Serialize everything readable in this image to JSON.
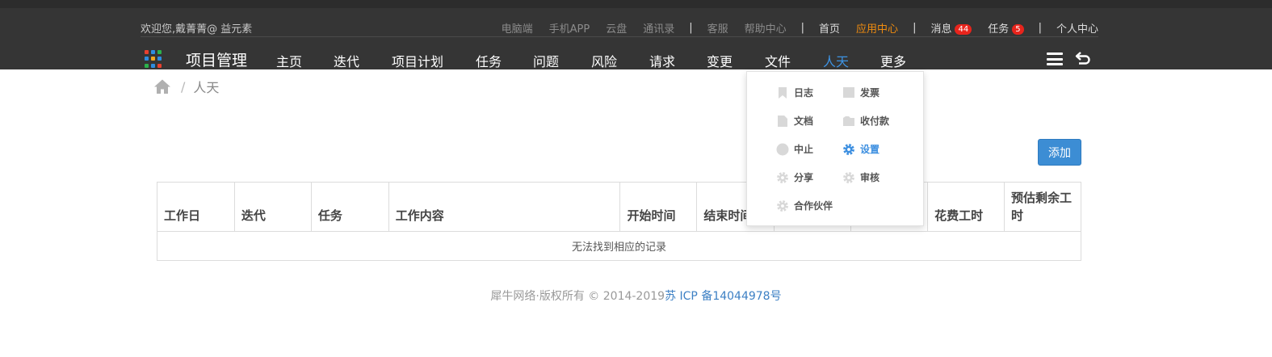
{
  "header": {
    "welcome": "欢迎您,戴菁菁@ 益元素",
    "utility_links": [
      {
        "label": "电脑端",
        "style": "dim"
      },
      {
        "label": "手机APP",
        "style": "dim"
      },
      {
        "label": "云盘",
        "style": "dim"
      },
      {
        "label": "通讯录",
        "style": "dim"
      },
      {
        "label": "客服",
        "style": "dim"
      },
      {
        "label": "帮助中心",
        "style": "dim"
      },
      {
        "label": "首页",
        "style": "light"
      },
      {
        "label": "应用中心",
        "style": "accent"
      },
      {
        "label": "消息",
        "badge": "44"
      },
      {
        "label": "任务",
        "badge": "5"
      },
      {
        "label": "个人中心",
        "style": "light"
      }
    ],
    "separator": "|",
    "brand": "项目管理",
    "nav": [
      "主页",
      "迭代",
      "项目计划",
      "任务",
      "问题",
      "风险",
      "请求",
      "变更",
      "文件",
      "人天",
      "更多"
    ],
    "active_nav": "人天",
    "icons": {
      "apps": "apps-grid-icon",
      "menu": "hamburger-menu-icon",
      "back": "back-arrow-icon"
    }
  },
  "breadcrumb": {
    "separator": "/",
    "current": "人天"
  },
  "toolbar": {
    "add_label": "添加"
  },
  "table": {
    "columns": [
      "工作日",
      "迭代",
      "任务",
      "工作内容",
      "开始时间",
      "结束时间",
      "",
      "",
      "花费工时",
      "预估剩余工时"
    ],
    "empty_text": "无法找到相应的记录"
  },
  "dropdown": {
    "items": [
      {
        "label": "日志",
        "icon": "bookmark-icon"
      },
      {
        "label": "发票",
        "icon": "invoice-icon"
      },
      {
        "label": "文档",
        "icon": "document-icon"
      },
      {
        "label": "收付款",
        "icon": "folder-icon"
      },
      {
        "label": "中止",
        "icon": "stop-circle-icon"
      },
      {
        "label": "设置",
        "icon": "gear-icon",
        "active": true
      },
      {
        "label": "分享",
        "icon": "share-gear-icon"
      },
      {
        "label": "审核",
        "icon": "review-gear-icon"
      },
      {
        "label": "合作伙伴",
        "icon": "partner-gear-icon"
      }
    ]
  },
  "footer": {
    "copyright": "犀牛网络·版权所有 © 2014-2019",
    "icp": "苏 ICP 备14044978号"
  },
  "colors": {
    "header_bg": "#353535",
    "accent_orange": "#f08c0f",
    "active_blue": "#3d93e3",
    "button_blue": "#3c8dd4",
    "badge_red": "#e8241c"
  }
}
